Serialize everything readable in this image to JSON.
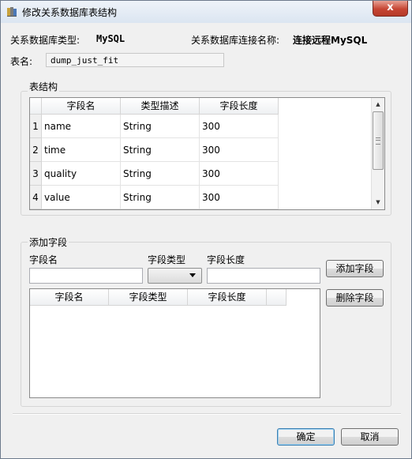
{
  "window": {
    "title": "修改关系数据库表结构",
    "close_label": "x"
  },
  "info": {
    "db_type_label": "关系数据库类型:",
    "db_type_value": "MySQL",
    "conn_name_label": "关系数据库连接名称:",
    "conn_name_value": "连接远程MySQL",
    "table_name_label": "表名:",
    "table_name_value": "dump_just_fit"
  },
  "structure": {
    "title": "表结构",
    "columns": [
      "字段名",
      "类型描述",
      "字段长度"
    ],
    "rows": [
      {
        "num": "1",
        "name": "name",
        "type": "String",
        "length": "300"
      },
      {
        "num": "2",
        "name": "time",
        "type": "String",
        "length": "300"
      },
      {
        "num": "3",
        "name": "quality",
        "type": "String",
        "length": "300"
      },
      {
        "num": "4",
        "name": "value",
        "type": "String",
        "length": "300"
      }
    ]
  },
  "add_field": {
    "title": "添加字段",
    "name_label": "字段名",
    "type_label": "字段类型",
    "length_label": "字段长度",
    "name_value": "",
    "type_value": "",
    "length_value": "",
    "add_button": "添加字段",
    "delete_button": "删除字段",
    "list_columns": [
      "字段名",
      "字段类型",
      "字段长度"
    ]
  },
  "buttons": {
    "ok": "确定",
    "cancel": "取消"
  },
  "icons": {
    "app": "database-app-icon",
    "close": "close-icon",
    "dropdown": "chevron-down-icon",
    "scroll_up": "arrow-up-icon",
    "scroll_down": "arrow-down-icon"
  }
}
